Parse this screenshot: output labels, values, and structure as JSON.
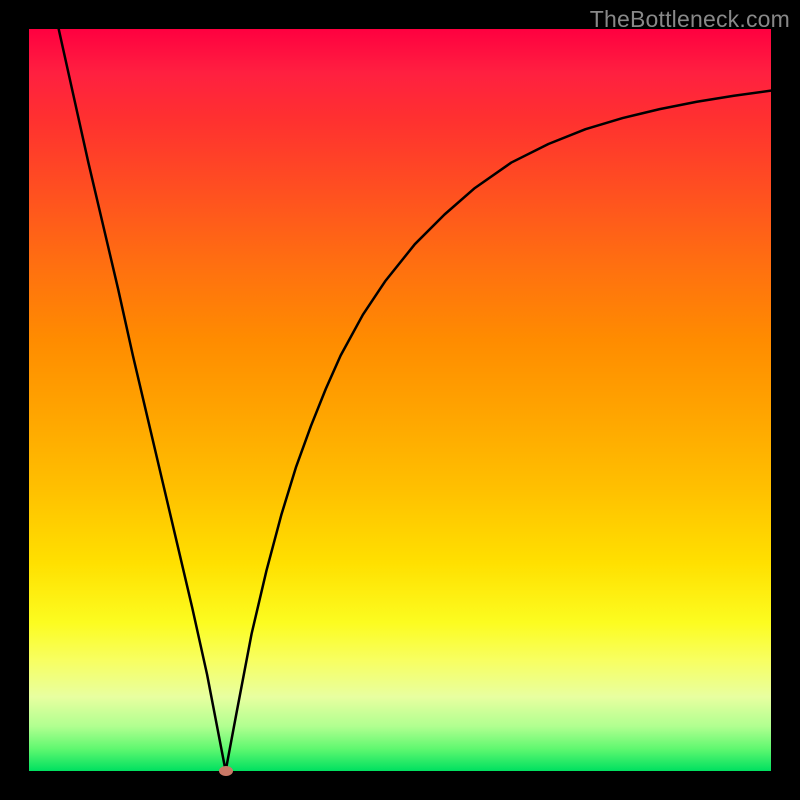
{
  "watermark": "TheBottleneck.com",
  "chart_data": {
    "type": "line",
    "title": "",
    "xlabel": "",
    "ylabel": "",
    "xlim": [
      0,
      100
    ],
    "ylim": [
      0,
      100
    ],
    "min_point": {
      "x": 26.5,
      "y": 0
    },
    "series": [
      {
        "name": "curve",
        "x": [
          4,
          6,
          8,
          10,
          12,
          14,
          16,
          18,
          20,
          22,
          24,
          26.5,
          28,
          30,
          32,
          34,
          36,
          38,
          40,
          42,
          45,
          48,
          52,
          56,
          60,
          65,
          70,
          75,
          80,
          85,
          90,
          95,
          100
        ],
        "values": [
          100,
          91,
          82,
          73.5,
          65,
          56,
          47.5,
          39,
          30.5,
          22,
          13,
          0,
          8,
          18.5,
          27,
          34.5,
          41,
          46.5,
          51.5,
          56,
          61.5,
          66,
          71,
          75,
          78.5,
          82,
          84.5,
          86.5,
          88,
          89.2,
          90.2,
          91,
          91.7
        ]
      }
    ],
    "marker": {
      "x": 26.5,
      "y": 0,
      "color": "#c97866"
    },
    "background_gradient": {
      "direction": "vertical",
      "stops": [
        {
          "pos": 0,
          "color": "#ff0040"
        },
        {
          "pos": 50,
          "color": "#ffa500"
        },
        {
          "pos": 80,
          "color": "#fcfc20"
        },
        {
          "pos": 100,
          "color": "#00e060"
        }
      ]
    }
  }
}
